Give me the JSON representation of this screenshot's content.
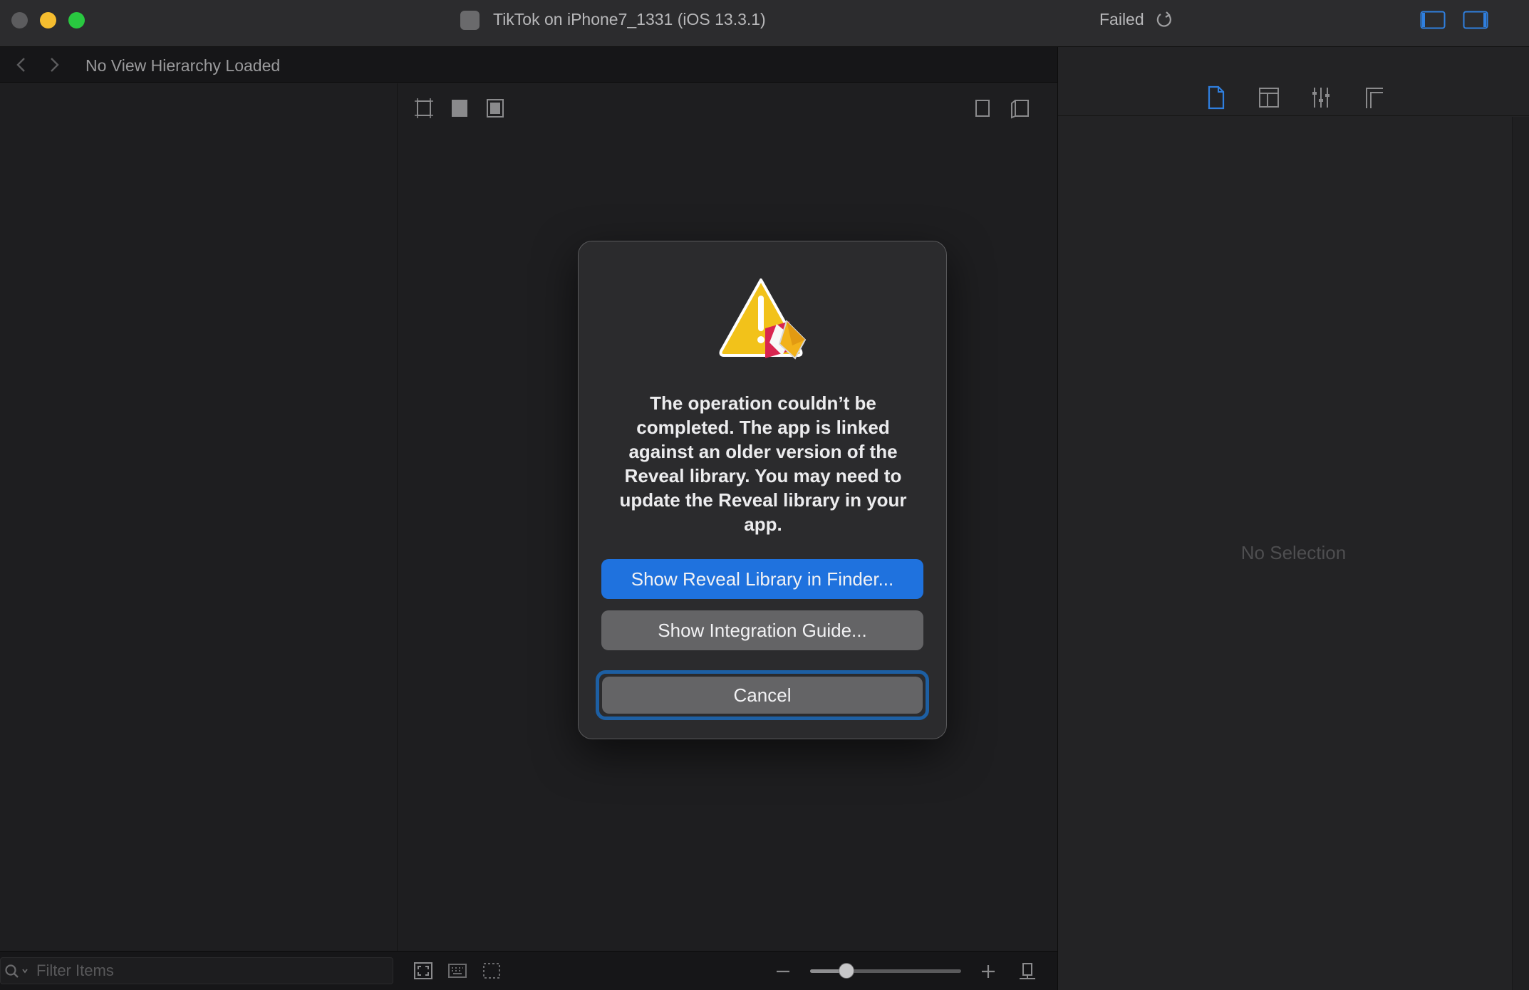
{
  "window": {
    "title": "TikTok on iPhone7_1331 (iOS 13.3.1)",
    "status": "Failed"
  },
  "nav": {
    "title": "No View Hierarchy Loaded"
  },
  "inspector": {
    "empty_label": "No Selection"
  },
  "filter": {
    "placeholder": "Filter Items",
    "value": ""
  },
  "zoom": {
    "level": 0.24
  },
  "dialog": {
    "message": "The operation couldn’t be completed. The app is linked against an older version of the Reveal library. You may need to update the Reveal library in your app.",
    "primary_button": "Show Reveal Library in Finder...",
    "secondary_button": "Show Integration Guide...",
    "cancel_button": "Cancel"
  },
  "colors": {
    "accent": "#1f72de",
    "warning": "#f2c21a",
    "background": "#1e1e20"
  }
}
